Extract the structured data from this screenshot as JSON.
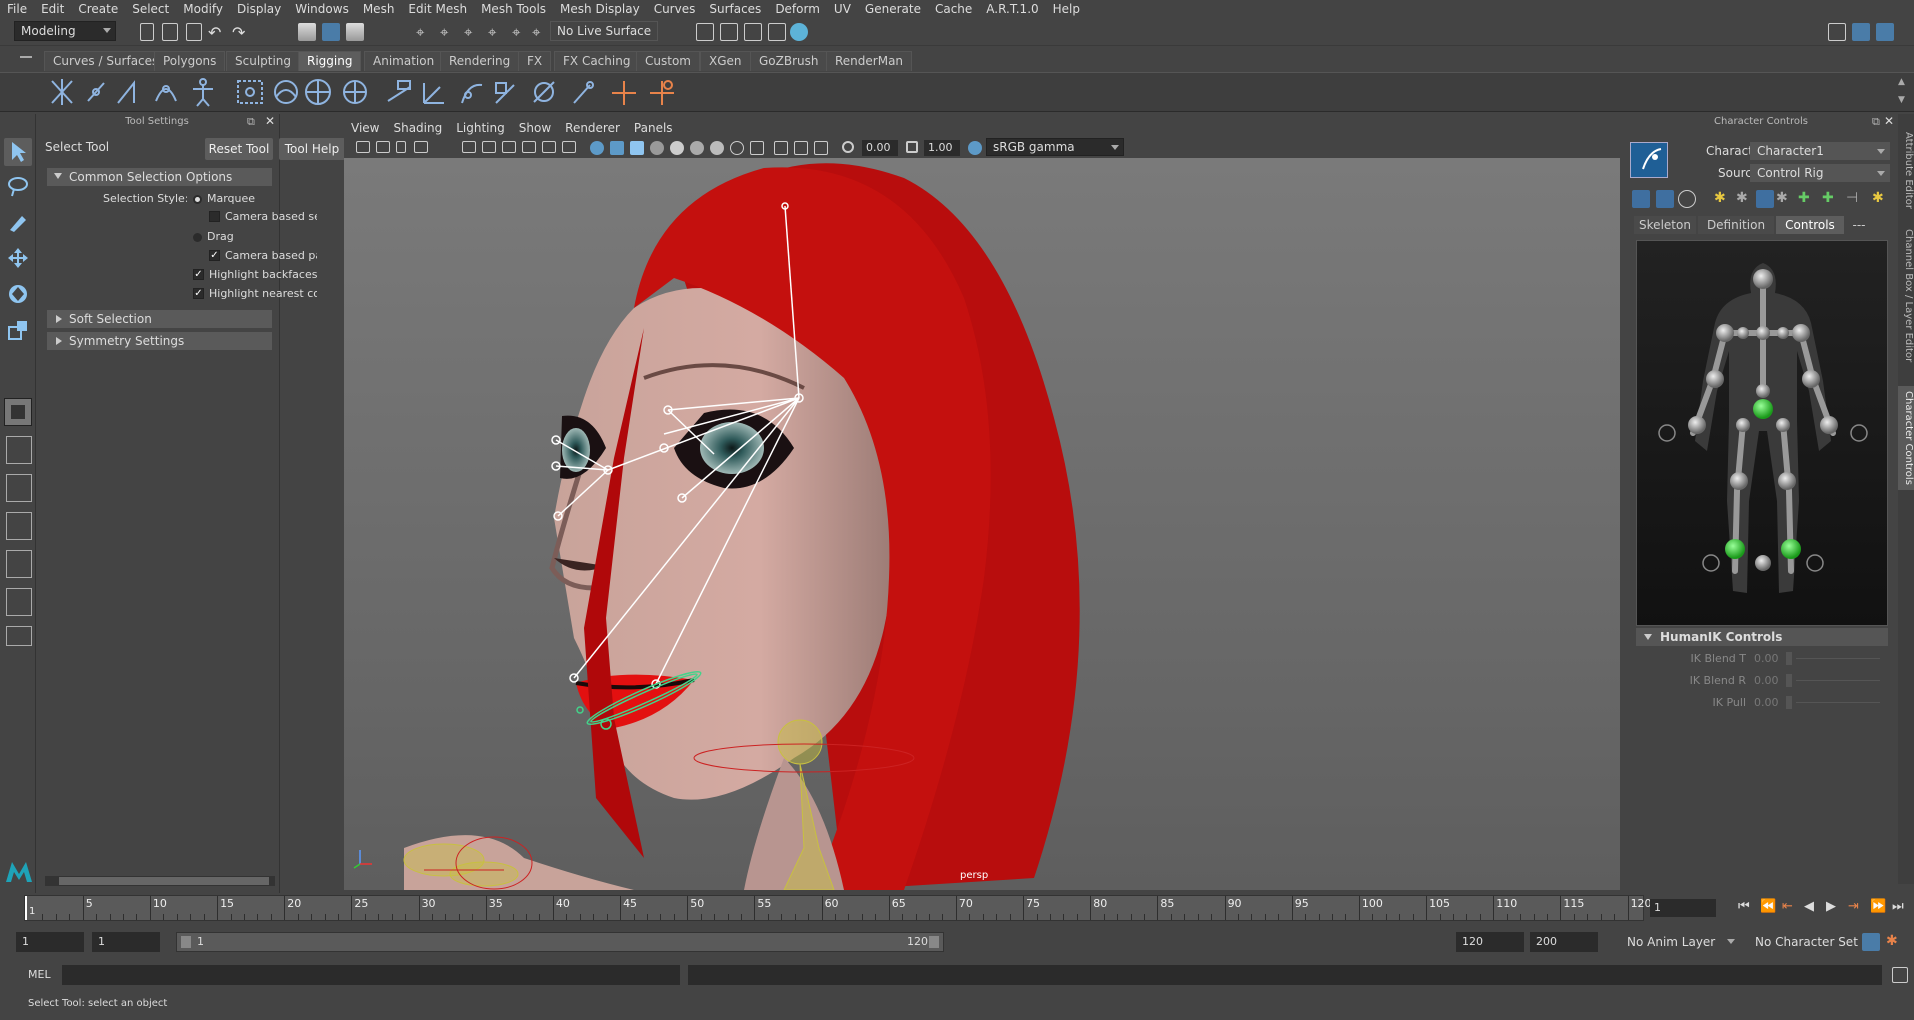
{
  "menubar": [
    "File",
    "Edit",
    "Create",
    "Select",
    "Modify",
    "Display",
    "Windows",
    "Mesh",
    "Edit Mesh",
    "Mesh Tools",
    "Mesh Display",
    "Curves",
    "Surfaces",
    "Deform",
    "UV",
    "Generate",
    "Cache",
    "A.R.T.1.0",
    "Help"
  ],
  "statusline": {
    "mode": "Modeling",
    "live_surface": "No Live Surface"
  },
  "shelf": {
    "tabs": [
      "Curves / Surfaces",
      "Polygons",
      "Sculpting",
      "Rigging",
      "Animation",
      "Rendering",
      "FX",
      "FX Caching",
      "Custom",
      "XGen",
      "GoZBrush",
      "RenderMan"
    ],
    "active": "Rigging"
  },
  "tool_settings": {
    "panel_title": "Tool Settings",
    "tool_name": "Select Tool",
    "reset_button": "Reset Tool",
    "help_button": "Tool Help",
    "section_common": "Common Selection Options",
    "selection_style_label": "Selection Style:",
    "marquee": "Marquee",
    "camera_based_selection": "Camera based selecti",
    "drag": "Drag",
    "camera_based_paint": "Camera based paint s",
    "highlight_backfaces": "Highlight backfaces",
    "highlight_nearest": "Highlight nearest compo",
    "section_soft": "Soft Selection",
    "section_symmetry": "Symmetry Settings"
  },
  "viewport": {
    "menus": [
      "View",
      "Shading",
      "Lighting",
      "Show",
      "Renderer",
      "Panels"
    ],
    "exposure": "0.00",
    "gamma": "1.00",
    "color_space": "sRGB gamma",
    "camera_label": "persp"
  },
  "character_controls": {
    "panel_title": "Character Controls",
    "character_label": "Character:",
    "character_value": "Character1",
    "source_label": "Source:",
    "source_value": "Control Rig",
    "tabs": [
      "Skeleton",
      "Definition",
      "Controls",
      "---"
    ],
    "active_tab": "Controls",
    "humanik_header": "HumanIK Controls",
    "sliders": [
      {
        "label": "IK Blend T",
        "value": "0.00"
      },
      {
        "label": "IK Blend R",
        "value": "0.00"
      },
      {
        "label": "IK Pull",
        "value": "0.00"
      }
    ]
  },
  "side_tabs": [
    "Attribute Editor",
    "Channel Box / Layer Editor",
    "Character Controls"
  ],
  "timeline": {
    "ticks": [
      "5",
      "10",
      "15",
      "20",
      "25",
      "30",
      "35",
      "40",
      "45",
      "50",
      "55",
      "60",
      "65",
      "70",
      "75",
      "80",
      "85",
      "90",
      "95",
      "100",
      "105",
      "110",
      "115",
      "120"
    ],
    "first_frame_marker": "1",
    "current_frame": "1"
  },
  "range": {
    "start": "1",
    "playback_start": "1",
    "slider_start": "1",
    "slider_end": "120",
    "playback_end": "120",
    "end": "200",
    "anim_layer": "No Anim Layer",
    "character_set": "No Character Set"
  },
  "command": {
    "label": "MEL"
  },
  "help_line": "Select Tool: select an object"
}
